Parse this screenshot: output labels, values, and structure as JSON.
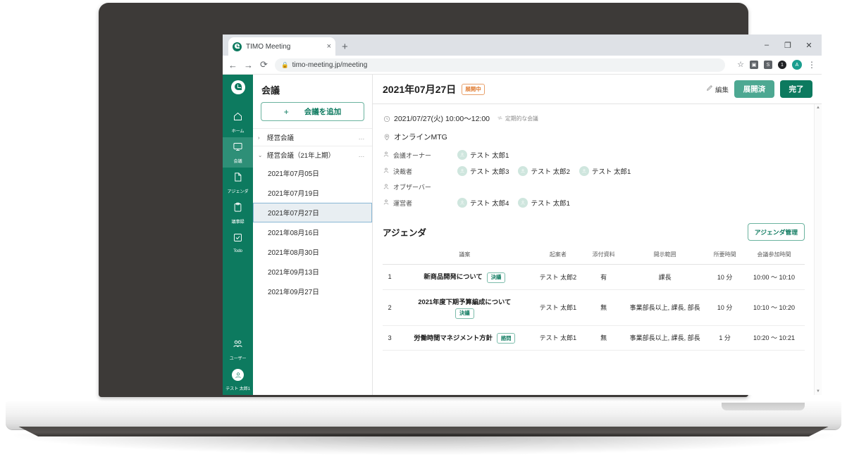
{
  "browser": {
    "tab_title": "TIMO Meeting",
    "tab_close": "×",
    "newtab": "+",
    "back": "←",
    "forward": "→",
    "reload": "⟳",
    "lock": "🔒",
    "url": "timo-meeting.jp/meeting",
    "star": "☆",
    "ext_badge_label": "S",
    "ext_dot_label": "1",
    "profile_initial": "A",
    "kebab": "⋮",
    "minimize": "–",
    "maximize": "❐",
    "close": "✕"
  },
  "navrail": {
    "items": [
      {
        "label": "ホーム",
        "icon": "home-icon",
        "active": false
      },
      {
        "label": "会議",
        "icon": "meeting-icon",
        "active": true
      },
      {
        "label": "アジェンダ",
        "icon": "document-icon",
        "active": false
      },
      {
        "label": "議事録",
        "icon": "clipboard-icon",
        "active": false
      },
      {
        "label": "Todo",
        "icon": "checkbox-icon",
        "active": false
      }
    ],
    "users_label": "ユーザー",
    "users_icon": "users-icon",
    "current_user": "テスト 太郎1",
    "avatar_icon": "person-icon"
  },
  "list_panel": {
    "title": "会議",
    "add_button": "会議を追加",
    "add_plus": "+",
    "groups": [
      {
        "caret": "›",
        "name": "経営会議",
        "dots": "…",
        "expanded": false,
        "dates": []
      },
      {
        "caret": "⌄",
        "name": "経営会議（21年上期）",
        "dots": "…",
        "expanded": true,
        "dates": [
          {
            "label": "2021年07月05日",
            "selected": false
          },
          {
            "label": "2021年07月19日",
            "selected": false
          },
          {
            "label": "2021年07月27日",
            "selected": true
          },
          {
            "label": "2021年08月16日",
            "selected": false
          },
          {
            "label": "2021年08月30日",
            "selected": false
          },
          {
            "label": "2021年09月13日",
            "selected": false
          },
          {
            "label": "2021年09月27日",
            "selected": false
          }
        ]
      }
    ]
  },
  "content_header": {
    "title": "2021年07月27日",
    "status_badge": "展開中",
    "edit_label": "編集",
    "edit_icon": "pencil-icon",
    "secondary_button": "展開済",
    "primary_button": "完了"
  },
  "meeting": {
    "datetime": "2021/07/27(火) 10:00〜12:00",
    "clock_icon": "clock-icon",
    "recurring_label": "定期的な会議",
    "recurring_icon": "repeat-icon",
    "location": "オンラインMTG",
    "location_icon": "pin-icon",
    "roles": [
      {
        "label": "会議オーナー",
        "icon": "person-icon",
        "people": [
          "テスト 太郎1"
        ]
      },
      {
        "label": "決裁者",
        "icon": "person-icon",
        "people": [
          "テスト 太郎3",
          "テスト 太郎2",
          "テスト 太郎1"
        ]
      },
      {
        "label": "オブザーバー",
        "icon": "person-icon",
        "people": []
      },
      {
        "label": "運営者",
        "icon": "person-icon",
        "people": [
          "テスト 太郎4",
          "テスト 太郎1"
        ]
      }
    ]
  },
  "agenda": {
    "title": "アジェンダ",
    "manage_button": "アジェンダ管理",
    "columns": [
      "",
      "議案",
      "起案者",
      "添付資料",
      "開示範囲",
      "所要時間",
      "会議参加時間"
    ],
    "rows": [
      {
        "no": "1",
        "topic": "新商品開発について",
        "kind": "決議",
        "kind_block": false,
        "owner": "テスト 太郎2",
        "attachment": "有",
        "scope": "課長",
        "duration": "10 分",
        "time": "10:00 〜 10:10"
      },
      {
        "no": "2",
        "topic": "2021年度下期予算編成について",
        "kind": "決議",
        "kind_block": true,
        "owner": "テスト 太郎1",
        "attachment": "無",
        "scope": "事業部長以上, 課長, 部長",
        "duration": "10 分",
        "time": "10:10 〜 10:20"
      },
      {
        "no": "3",
        "topic": "労働時間マネジメント方針",
        "kind": "諮問",
        "kind_block": false,
        "owner": "テスト 太郎1",
        "attachment": "無",
        "scope": "事業部長以上, 課長, 部長",
        "duration": "1 分",
        "time": "10:20 〜 10:21"
      }
    ]
  },
  "scrollbar": {
    "up": "▲",
    "down": "▼"
  },
  "colors": {
    "brand_green": "#0d7a5f",
    "light_green": "#4da892",
    "orange": "#e07a2f",
    "selected_blue": "#e8eef2"
  }
}
